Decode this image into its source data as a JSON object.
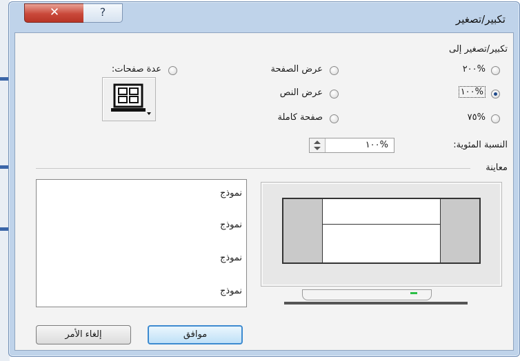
{
  "window": {
    "title": "تكبير/تصغير",
    "close_glyph": "✕",
    "help_glyph": "?"
  },
  "zoom_group": {
    "label": "تكبير/تصغير إلى",
    "options": {
      "zoom_200": "%٢٠٠",
      "zoom_100": "%١٠٠",
      "zoom_75": "%٧٥",
      "page_width": "عرض الصفحة",
      "text_width": "عرض النص",
      "whole_page": "صفحة كاملة",
      "many_pages": "عدة صفحات:"
    },
    "selected": "zoom_100"
  },
  "percent": {
    "label": "النسبة المئوية:",
    "value": "%١٠٠"
  },
  "preview": {
    "label": "معاينة",
    "samples": [
      "نموذج",
      "نموذج",
      "نموذج",
      "نموذج"
    ]
  },
  "buttons": {
    "ok": "موافق",
    "cancel": "إلغاء الأمر"
  }
}
